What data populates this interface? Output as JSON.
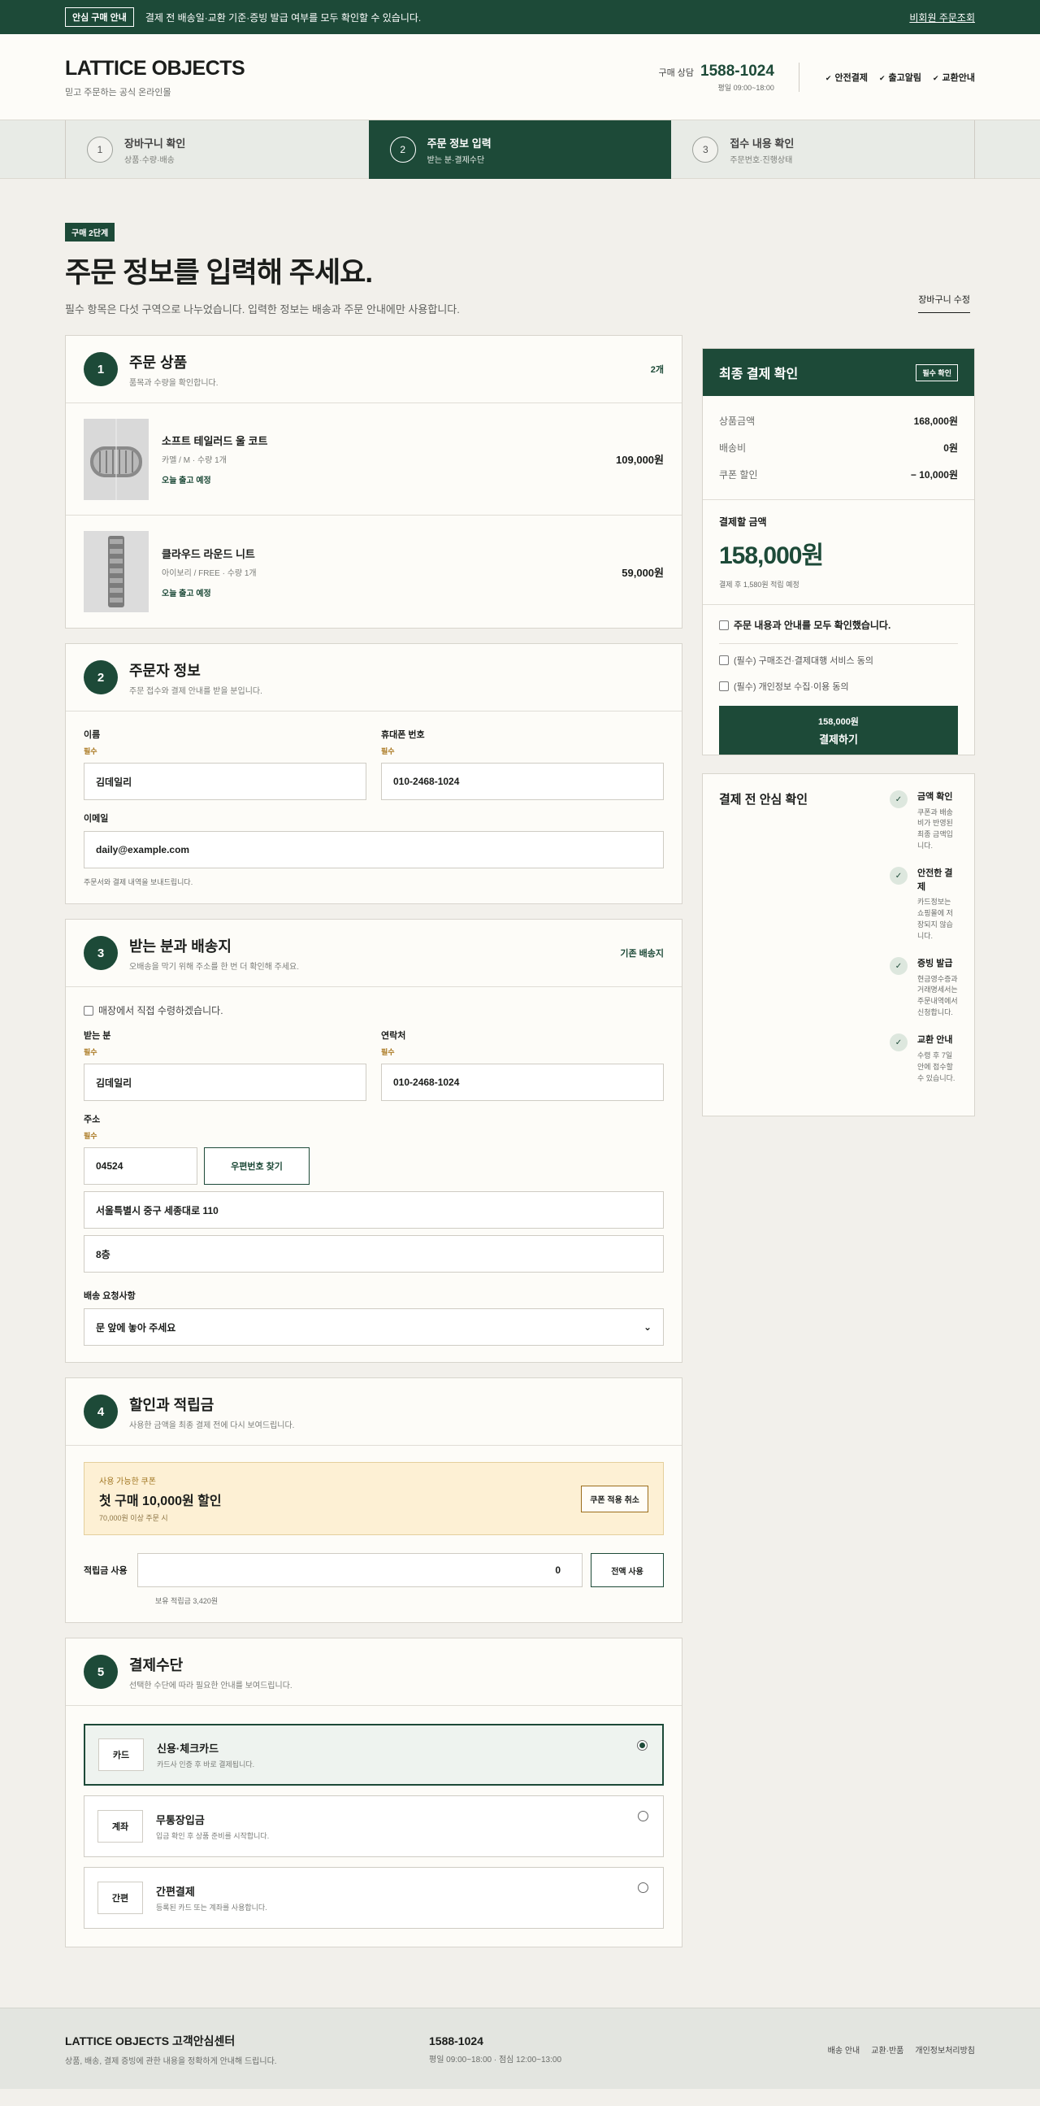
{
  "topbar": {
    "badge": "안심 구매 안내",
    "text": "결제 전 배송일·교환 기준·증빙 발급 여부를 모두 확인할 수 있습니다.",
    "link": "비회원 주문조회"
  },
  "header": {
    "logo": "LATTICE OBJECTS",
    "logo_sub": "믿고 주문하는 공식 온라인몰",
    "contact_label": "구매 상담",
    "contact_number": "1588-1024",
    "contact_hours": "평일 09:00~18:00",
    "assurances": [
      "안전결제",
      "출고알림",
      "교환안내"
    ]
  },
  "steps": [
    {
      "num": "1",
      "title": "장바구니 확인",
      "sub": "상품·수량·배송"
    },
    {
      "num": "2",
      "title": "주문 정보 입력",
      "sub": "받는 분·결제수단"
    },
    {
      "num": "3",
      "title": "접수 내용 확인",
      "sub": "주문번호·진행상태"
    }
  ],
  "page": {
    "badge": "구매 2단계",
    "title": "주문 정보를 입력해 주세요.",
    "desc": "필수 항목은 다섯 구역으로 나누었습니다. 입력한 정보는 배송과 주문 안내에만 사용합니다.",
    "edit_cart": "장바구니 수정"
  },
  "products": {
    "num": "1",
    "title": "주문 상품",
    "sub": "품목과 수량을 확인합니다.",
    "count": "2개",
    "items": [
      {
        "name": "소프트 테일러드 울 코트",
        "option": "카멜 / M · 수량 1개",
        "ship": "오늘 출고 예정",
        "price": "109,000원"
      },
      {
        "name": "클라우드 라운드 니트",
        "option": "아이보리 / FREE · 수량 1개",
        "ship": "오늘 출고 예정",
        "price": "59,000원"
      }
    ]
  },
  "orderer": {
    "num": "2",
    "title": "주문자 정보",
    "sub": "주문 접수와 결제 안내를 받을 분입니다.",
    "name_label": "이름",
    "required": "필수",
    "name_value": "김데일리",
    "phone_label": "휴대폰 번호",
    "phone_value": "010-2468-1024",
    "email_label": "이메일",
    "email_value": "daily@example.com",
    "email_note": "주문서와 결제 내역을 보내드립니다."
  },
  "shipping": {
    "num": "3",
    "title": "받는 분과 배송지",
    "sub": "오배송을 막기 위해 주소를 한 번 더 확인해 주세요.",
    "default_addr": "기존 배송지",
    "pickup": "매장에서 직접 수령하겠습니다.",
    "recv_label": "받는 분",
    "required": "필수",
    "recv_value": "김데일리",
    "tel_label": "연락처",
    "tel_value": "010-2468-1024",
    "addr_label": "주소",
    "zip": "04524",
    "zip_btn": "우편번호 찾기",
    "addr1": "서울특별시 중구 세종대로 110",
    "addr2": "8층",
    "memo_label": "배송 요청사항",
    "memo_value": "문 앞에 놓아 주세요"
  },
  "discount": {
    "num": "4",
    "title": "할인과 적립금",
    "sub": "사용한 금액을 최종 결제 전에 다시 보여드립니다.",
    "coupon_label": "사용 가능한 쿠폰",
    "coupon_title": "첫 구매 10,000원 할인",
    "coupon_cond": "70,000원 이상 주문 시",
    "coupon_btn": "쿠폰 적용 취소",
    "points_label": "적립금 사용",
    "points_value": "0",
    "points_btn": "전액 사용",
    "points_balance": "보유 적립금 3,420원"
  },
  "payment": {
    "num": "5",
    "title": "결제수단",
    "sub": "선택한 수단에 따라 필요한 안내를 보여드립니다.",
    "methods": [
      {
        "tag": "카드",
        "title": "신용·체크카드",
        "desc": "카드사 인증 후 바로 결제됩니다."
      },
      {
        "tag": "계좌",
        "title": "무통장입금",
        "desc": "입금 확인 후 상품 준비를 시작합니다."
      },
      {
        "tag": "간편",
        "title": "간편결제",
        "desc": "등록된 카드 또는 계좌를 사용합니다."
      }
    ]
  },
  "summary": {
    "title": "최종 결제 확인",
    "badge": "필수 확인",
    "lines": [
      {
        "label": "상품금액",
        "value": "168,000원"
      },
      {
        "label": "배송비",
        "value": "0원"
      },
      {
        "label": "쿠폰 할인",
        "value": "− 10,000원"
      }
    ],
    "total_label": "결제할 금액",
    "total_value": "158,000원",
    "points_note": "결제 후 1,580원 적립 예정",
    "agree_all": "주문 내용과 안내를 모두 확인했습니다.",
    "agree_1": "(필수) 구매조건·결제대행 서비스 동의",
    "agree_2": "(필수) 개인정보 수집·이용 동의",
    "pay_amount": "158,000원",
    "pay_label": "결제하기"
  },
  "safety": {
    "title": "결제 전 안심 확인",
    "items": [
      {
        "title": "금액 확인",
        "desc": "쿠폰과 배송비가 반영된 최종 금액입니다."
      },
      {
        "title": "안전한 결제",
        "desc": "카드정보는 쇼핑몰에 저장되지 않습니다."
      },
      {
        "title": "증빙 발급",
        "desc": "현금영수증과 거래명세서는 주문내역에서 신청합니다."
      },
      {
        "title": "교환 안내",
        "desc": "수령 후 7일 안에 접수할 수 있습니다."
      }
    ]
  },
  "footer": {
    "name": "LATTICE OBJECTS 고객안심센터",
    "desc": "상품, 배송, 결제 증빙에 관한 내용을 정확하게 안내해 드립니다.",
    "number": "1588-1024",
    "hours": "평일 09:00~18:00 · 점심 12:00~13:00",
    "links": [
      "배송 안내",
      "교환·반품",
      "개인정보처리방침"
    ]
  }
}
